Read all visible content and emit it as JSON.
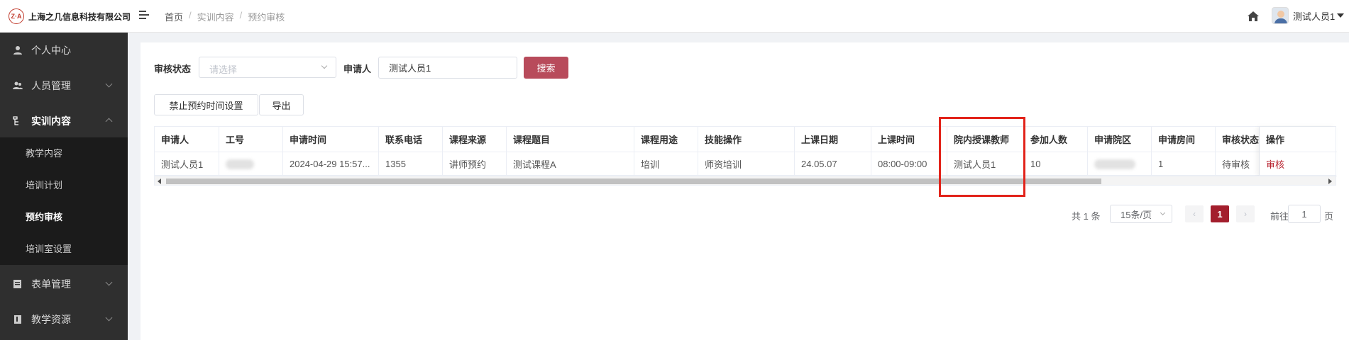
{
  "header": {
    "logo_mark": "Z·A",
    "logo_text": "上海之几信息科技有限公司",
    "breadcrumb": [
      "首页",
      "实训内容",
      "预约审核"
    ],
    "user_name": "测试人员1"
  },
  "sidebar": {
    "items": [
      {
        "label": "个人中心",
        "icon": "user-icon"
      },
      {
        "label": "人员管理",
        "icon": "users-icon"
      },
      {
        "label": "实训内容",
        "icon": "tree-icon"
      },
      {
        "label": "表单管理",
        "icon": "form-icon"
      },
      {
        "label": "教学资源",
        "icon": "book-icon"
      }
    ],
    "sub_items": [
      {
        "label": "教学内容"
      },
      {
        "label": "培训计划"
      },
      {
        "label": "预约审核"
      },
      {
        "label": "培训室设置"
      }
    ]
  },
  "filters": {
    "status_label": "审核状态",
    "status_placeholder": "请选择",
    "applicant_label": "申请人",
    "applicant_value": "测试人员1",
    "search_label": "搜索"
  },
  "toolbar": {
    "disable_time_label": "禁止预约时间设置",
    "export_label": "导出"
  },
  "table": {
    "columns": [
      "申请人",
      "工号",
      "申请时间",
      "联系电话",
      "课程来源",
      "课程题目",
      "课程用途",
      "技能操作",
      "上课日期",
      "上课时间",
      "院内授课教师",
      "参加人数",
      "申请院区",
      "申请房间",
      "审核状态",
      "操作"
    ],
    "rows": [
      {
        "applicant": "测试人员1",
        "staff_no": "",
        "apply_time": "2024-04-29 15:57...",
        "phone": "1355",
        "source": "讲师预约",
        "course": "测试课程A",
        "purpose": "培训",
        "skill": "师资培训",
        "date": "24.05.07",
        "time": "08:00-09:00",
        "teacher": "测试人员1",
        "count": "10",
        "campus": "",
        "room": "1",
        "status": "待审核",
        "action": "审核"
      }
    ]
  },
  "pagination": {
    "total": "共 1 条",
    "page_size": "15条/页",
    "current_page": "1",
    "goto_label": "前往",
    "goto_value": "1",
    "page_suffix": "页"
  },
  "colors": {
    "accent": "#a31e2d",
    "search_button": "#b84b5b",
    "sidebar_bg": "#2f2f2f",
    "highlight": "#e2231a"
  }
}
